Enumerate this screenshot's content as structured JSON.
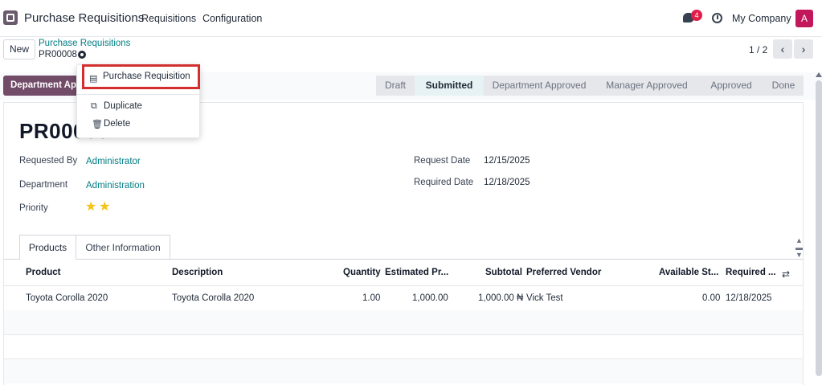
{
  "navbar": {
    "app_title": "Purchase Requisitions",
    "menu": [
      "Requisitions",
      "Configuration"
    ],
    "notification_count": "4",
    "company": "My Company",
    "avatar_letter": "A"
  },
  "control": {
    "new_label": "New",
    "breadcrumb": "Purchase Requisitions",
    "record_name": "PR00008",
    "pager": "1 / 2"
  },
  "actions_menu": {
    "print_label": "Purchase Requisition",
    "duplicate_label": "Duplicate",
    "delete_label": "Delete"
  },
  "status": {
    "action_button": "Department Approve",
    "stages": [
      "Draft",
      "Submitted",
      "Department Approved",
      "Manager Approved",
      "Approved",
      "Done"
    ],
    "current_stage": "Submitted"
  },
  "form": {
    "title": "PR00008",
    "requested_by_label": "Requested By",
    "requested_by": "Administrator",
    "department_label": "Department",
    "department": "Administration",
    "priority_label": "Priority",
    "priority_stars": 2,
    "request_date_label": "Request Date",
    "request_date": "12/15/2025",
    "required_date_label": "Required Date",
    "required_date": "12/18/2025"
  },
  "tabs": [
    "Products",
    "Other Information"
  ],
  "table": {
    "headers": [
      "Product",
      "Description",
      "Quantity",
      "Estimated Pr...",
      "Subtotal",
      "Preferred Vendor",
      "Available St...",
      "Required ..."
    ],
    "rows": [
      [
        "Toyota Corolla 2020",
        "Toyota Corolla 2020",
        "1.00",
        "1,000.00",
        "1,000.00 ₦",
        "Vick Test",
        "0.00",
        "12/18/2025"
      ]
    ]
  },
  "colors": {
    "brand": "#714b67",
    "link": "#017e84",
    "highlight_border": "#d32f2f",
    "star": "#f3c317",
    "badge": "#e11d48",
    "avatar": "#c2185b"
  }
}
